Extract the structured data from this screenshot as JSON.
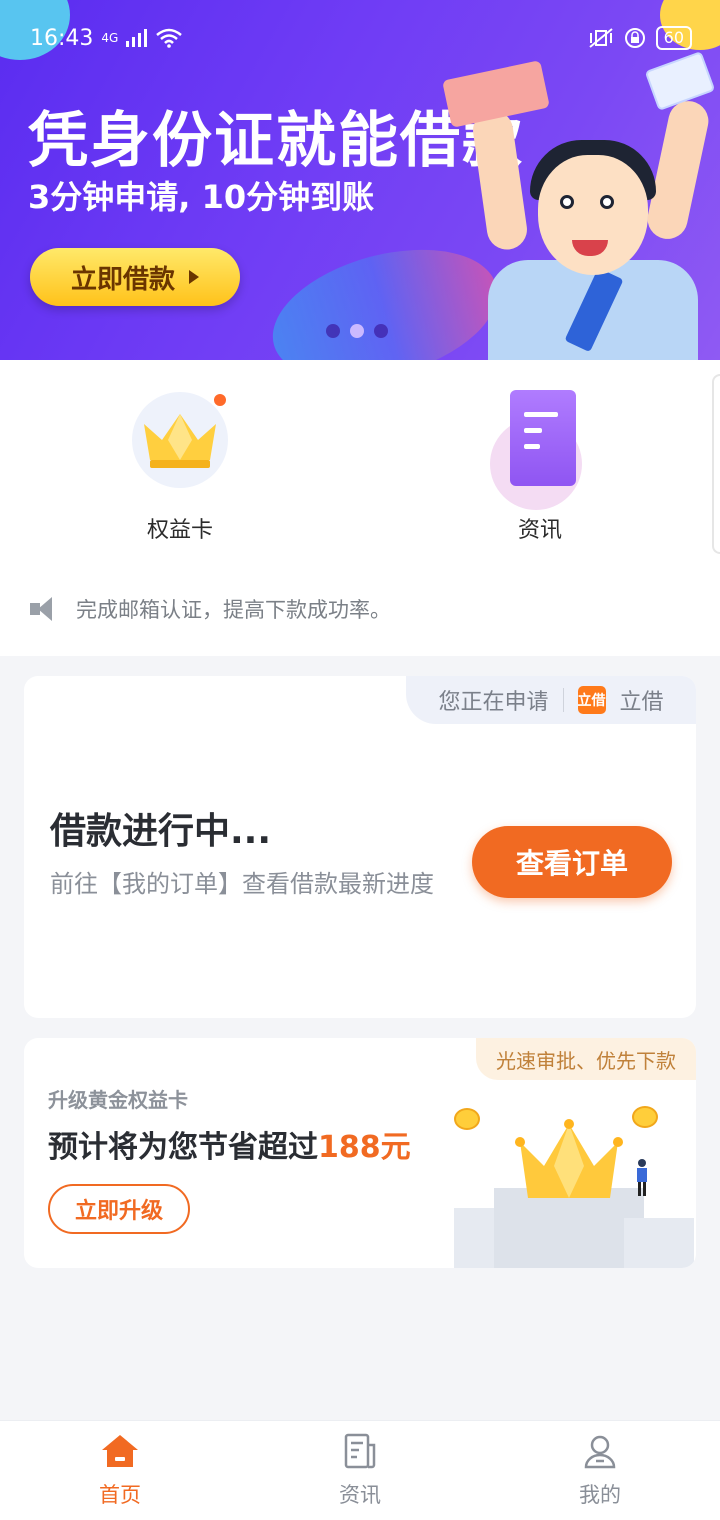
{
  "status_bar": {
    "time": "16:43",
    "network": "4G",
    "battery": "60"
  },
  "banner": {
    "headline": "凭身份证就能借款",
    "subline": "3分钟申请, 10分钟到账",
    "cta_label": "立即借款"
  },
  "quick_entries": [
    {
      "label": "权益卡",
      "icon": "crown-icon"
    },
    {
      "label": "资讯",
      "icon": "news-doc-icon"
    }
  ],
  "notice": {
    "text": "完成邮箱认证，提高下款成功率。"
  },
  "order_card": {
    "applying_label": "您正在申请",
    "brand_logo": "立借",
    "brand_name": "立借",
    "title": "借款进行中...",
    "desc": "前往【我的订单】查看借款最新进度",
    "button_label": "查看订单"
  },
  "upgrade_card": {
    "tag": "光速审批、优先下款",
    "subtitle": "升级黄金权益卡",
    "main_prefix": "预计将为您节省超过",
    "amount": "188元",
    "button_label": "立即升级"
  },
  "tabbar": [
    {
      "label": "首页",
      "icon": "home-icon",
      "active": true
    },
    {
      "label": "资讯",
      "icon": "news-icon",
      "active": false
    },
    {
      "label": "我的",
      "icon": "profile-icon",
      "active": false
    }
  ],
  "colors": {
    "accent": "#f16a22",
    "banner": "#6f3cf5",
    "gold": "#ffc21a"
  }
}
